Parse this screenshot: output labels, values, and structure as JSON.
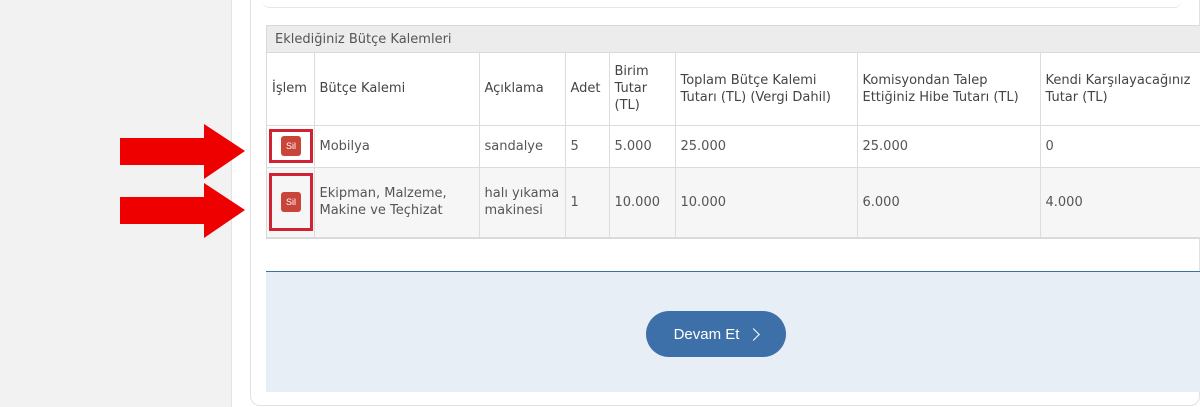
{
  "table": {
    "caption": "Eklediğiniz Bütçe Kalemleri",
    "headers": {
      "islem": "İşlem",
      "butce_kalemi": "Bütçe Kalemi",
      "aciklama": "Açıklama",
      "adet": "Adet",
      "birim_tutar": "Birim Tutar (TL)",
      "toplam": "Toplam Bütçe Kalemi Tutarı (TL) (Vergi Dahil)",
      "hibe": "Komisyondan Talep Ettiğiniz Hibe Tutarı (TL)",
      "kendi": "Kendi Karşılayacağınız Tutar (TL)"
    },
    "rows": [
      {
        "action": "Sil",
        "kalem": "Mobilya",
        "aciklama": "sandalye",
        "adet": "5",
        "birim": "5.000",
        "toplam": "25.000",
        "hibe": "25.000",
        "kendi": "0"
      },
      {
        "action": "Sil",
        "kalem": "Ekipman, Malzeme, Makine ve Teçhizat",
        "aciklama": "halı yıkama makinesi",
        "adet": "1",
        "birim": "10.000",
        "toplam": "10.000",
        "hibe": "6.000",
        "kendi": "4.000"
      }
    ]
  },
  "footer": {
    "continue_label": "Devam Et"
  },
  "colors": {
    "delete_button": "#c9453a",
    "highlight_outline": "#d12233",
    "annotation_arrow": "#ee0000",
    "primary_button": "#3d6fa8",
    "footer_background": "#e8eef6"
  },
  "icons": {
    "continue": "chevron-right-icon",
    "annotation": "red-arrow-icon"
  }
}
